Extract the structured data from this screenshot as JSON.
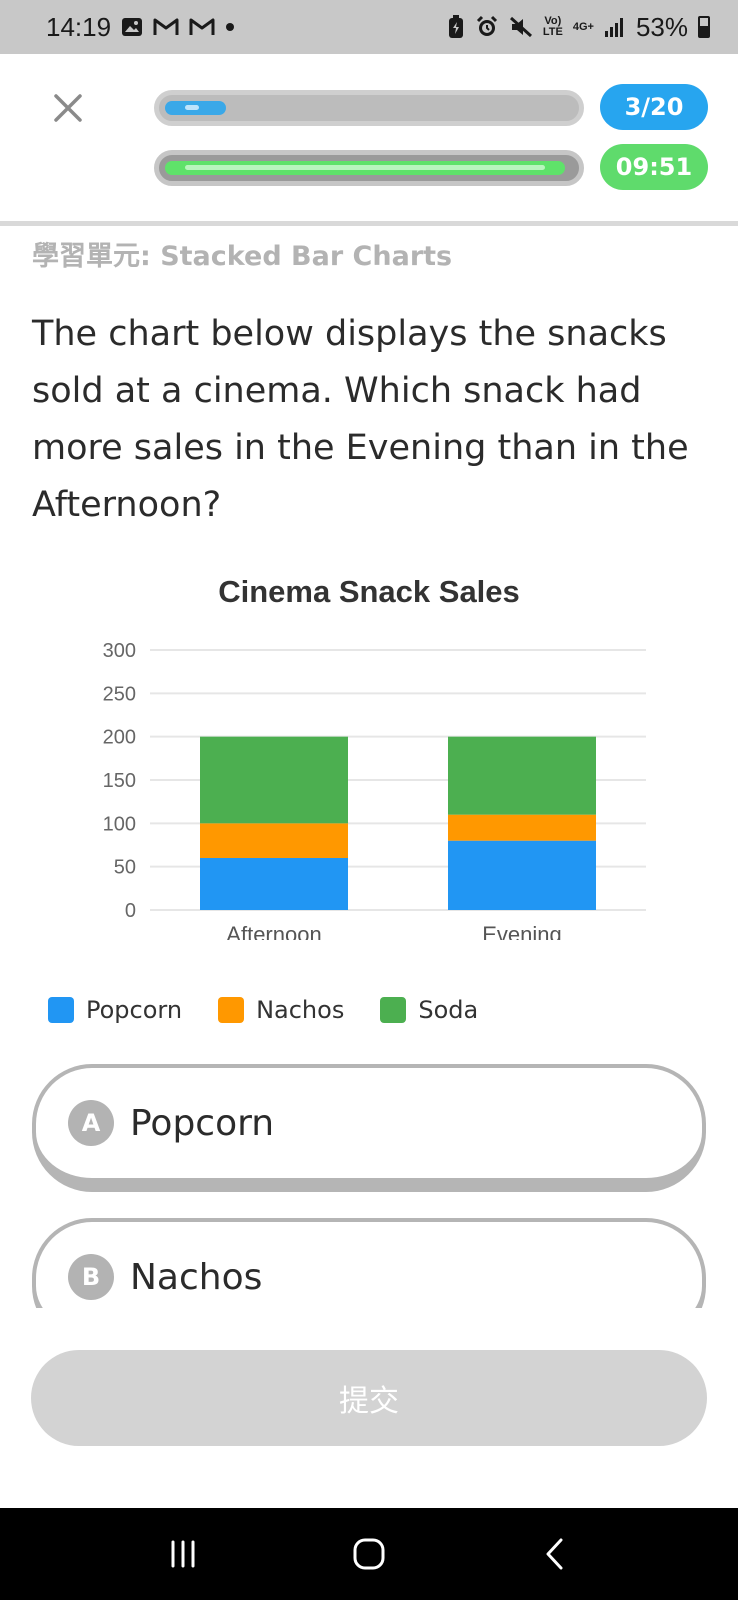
{
  "status_bar": {
    "time": "14:19",
    "battery": "53%",
    "network": "4G+"
  },
  "header": {
    "progress_label": "3/20",
    "progress_fraction": 0.15,
    "timer_label": "09:51",
    "timer_fraction": 0.98
  },
  "unit_label": "學習單元: Stacked Bar Charts",
  "question": "The chart below displays the snacks sold at a cinema. Which snack had more sales in the Evening than in the Afternoon?",
  "chart_data": {
    "type": "bar",
    "stacked": true,
    "title": "Cinema Snack Sales",
    "categories": [
      "Afternoon",
      "Evening"
    ],
    "series": [
      {
        "name": "Popcorn",
        "values": [
          60,
          80
        ],
        "color": "#2196f3"
      },
      {
        "name": "Nachos",
        "values": [
          40,
          30
        ],
        "color": "#ff9800"
      },
      {
        "name": "Soda",
        "values": [
          100,
          90
        ],
        "color": "#4caf50"
      }
    ],
    "ylim": [
      0,
      300
    ],
    "yticks": [
      0,
      50,
      100,
      150,
      200,
      250,
      300
    ],
    "grid": true,
    "legend": "bottom"
  },
  "options": [
    {
      "letter": "A",
      "text": "Popcorn"
    },
    {
      "letter": "B",
      "text": "Nachos"
    }
  ],
  "submit_label": "提交",
  "colors": {
    "accent_blue": "#27a5ef",
    "accent_green": "#5fdb6c",
    "disabled": "#d3d3d3"
  }
}
